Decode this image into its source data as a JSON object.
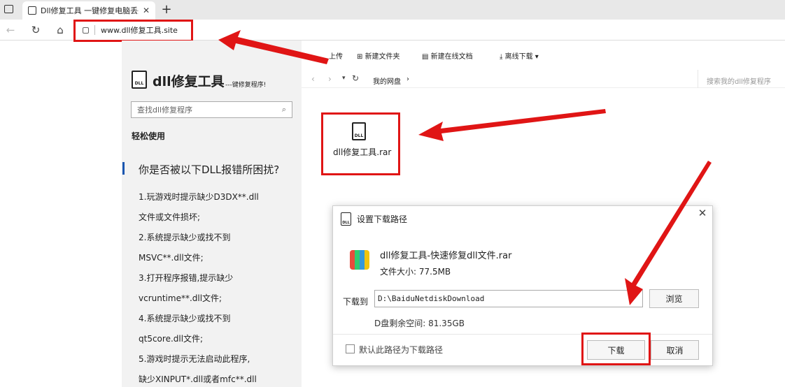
{
  "browser": {
    "tab_title": "Dll修复工具 一键修复电脑丢失D",
    "address": "www.dll修复工具.site"
  },
  "side": {
    "title": "dll修复工具",
    "subtitle": "---键修复程序!",
    "search_placeholder": "查找dll修复程序",
    "easy_use": "轻松使用",
    "question": "你是否被以下DLL报错所困扰?",
    "lines": [
      "1.玩游戏时提示缺少D3DX**.dll",
      "文件或文件损坏;",
      "2.系统提示缺少或找不到",
      "MSVC**.dll文件;",
      "3.打开程序报错,提示缺少",
      "vcruntime**.dll文件;",
      "4.系统提示缺少或找不到",
      "qt5core.dll文件;",
      "5.游戏时提示无法启动此程序,",
      "缺少XINPUT*.dll或者mfc**.dll"
    ]
  },
  "files": {
    "toolbar": {
      "upload": "上传",
      "new_folder": "新建文件夹",
      "new_doc": "新建在线文档",
      "offline": "离线下载"
    },
    "breadcrumb": "我的网盘",
    "search_placeholder": "搜索我的dll修复程序",
    "file_name": "dll修复工具.rar",
    "file_icon_text": "DLL"
  },
  "dialog": {
    "title": "设置下载路径",
    "file_name": "dll修复工具-快速修复dll文件.rar",
    "file_size": "文件大小: 77.5MB",
    "path_label": "下载到",
    "path_value": "D:\\BaiduNetdiskDownload",
    "browse": "浏览",
    "free_space": "D盘剩余空间: 81.35GB",
    "default_path": "默认此路径为下载路径",
    "download": "下载",
    "cancel": "取消"
  },
  "colors": {
    "highlight": "#e01515",
    "accent": "#1a56b0"
  }
}
